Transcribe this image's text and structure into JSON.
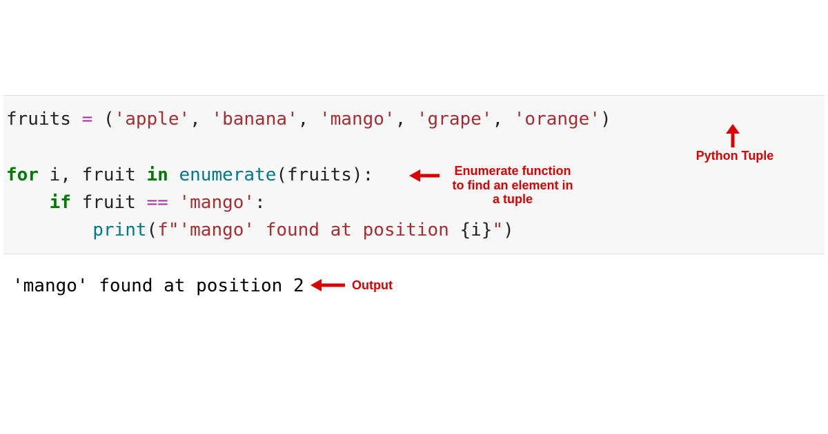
{
  "code": {
    "line1": {
      "variable": "fruits ",
      "equals": "= ",
      "lparen": "(",
      "s1": "'apple'",
      "c1": ", ",
      "s2": "'banana'",
      "c2": ", ",
      "s3": "'mango'",
      "c3": ", ",
      "s4": "'grape'",
      "c4": ", ",
      "s5": "'orange'",
      "rparen": ")"
    },
    "line2": {
      "kw_for": "for",
      "sp1": " ",
      "var_i": "i",
      "comma": ", ",
      "var_fruit": "fruit ",
      "kw_in": "in",
      "sp2": " ",
      "fn_enumerate": "enumerate",
      "lparen": "(",
      "arg": "fruits",
      "rparen": ")",
      "colon": ":"
    },
    "line3": {
      "indent": "    ",
      "kw_if": "if",
      "sp": " ",
      "var_fruit": "fruit ",
      "op_eq": "== ",
      "s_mango": "'mango'",
      "colon": ":"
    },
    "line4": {
      "indent": "        ",
      "fn_print": "print",
      "lparen": "(",
      "prefix_f": "f",
      "str_open": "\"'mango' found at position ",
      "brace_open": "{",
      "var_i": "i",
      "brace_close": "}",
      "str_close": "\"",
      "rparen": ")"
    }
  },
  "output": "'mango' found at position 2",
  "annotations": {
    "tuple": "Python Tuple",
    "enumerate": "Enumerate function\nto find an element in\na tuple",
    "output": "Output"
  }
}
